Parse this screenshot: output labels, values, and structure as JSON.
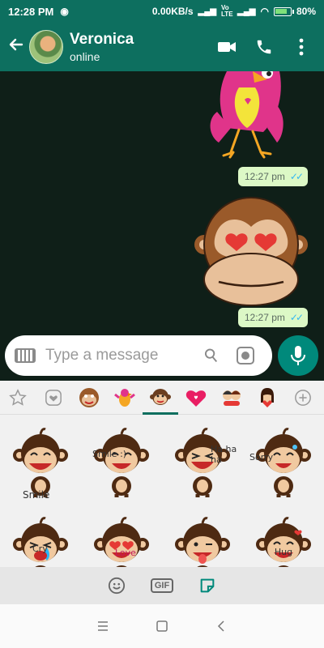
{
  "status_bar": {
    "time": "12:28 PM",
    "net_speed": "0.00KB/s",
    "network_label": "Vo LTE",
    "battery": "80%",
    "battery_level": 0.8
  },
  "header": {
    "contact_name": "Veronica",
    "contact_status": "online"
  },
  "messages": [
    {
      "type": "sticker",
      "sticker": "pink-bird",
      "time": "12:27 pm"
    },
    {
      "type": "sticker",
      "sticker": "monkey-heart-eyes",
      "time": "12:27 pm"
    }
  ],
  "composer": {
    "placeholder": "Type a message"
  },
  "sticker_tabs": [
    "recent-icon",
    "favorite-icon",
    "monkey-pack",
    "bird-pack",
    "monkey-pack-2",
    "love-pack",
    "couple-pack",
    "girl-pack",
    "add-icon"
  ],
  "stickers": [
    {
      "name": "monkey-smile",
      "caption": "Smile"
    },
    {
      "name": "monkey-smile-2",
      "caption": "Smile :)"
    },
    {
      "name": "monkey-haha",
      "caption": "Ha ha ha"
    },
    {
      "name": "monkey-sorry",
      "caption": "Sorry"
    },
    {
      "name": "monkey-cry",
      "caption": "Cry"
    },
    {
      "name": "monkey-love",
      "caption": "Love"
    },
    {
      "name": "monkey-tongue",
      "caption": ""
    },
    {
      "name": "monkey-hug",
      "caption": "Hug"
    }
  ],
  "colors": {
    "header": "#0d6f5f",
    "bubble": "#dcf8c6",
    "accent": "#00897b",
    "chat_bg": "#0f1f18"
  }
}
